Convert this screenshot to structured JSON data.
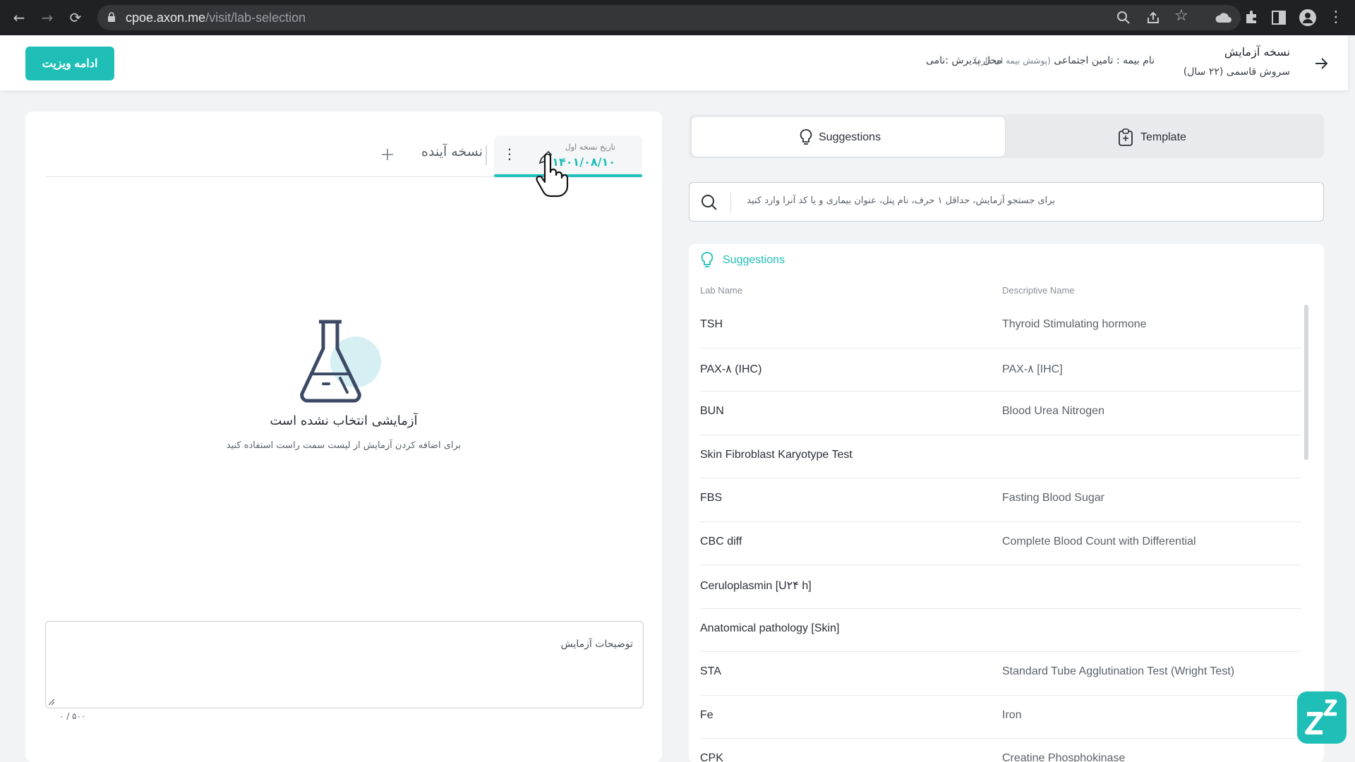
{
  "browser": {
    "url_host": "cpoe.axon.me",
    "url_path": "/visit/lab-selection"
  },
  "header": {
    "title": "نسخه آزمایش",
    "patient": "سروش قاسمی (۲۲ سال)",
    "insurance": "نام بیمه : تامین اجتماعی",
    "insurance_note": "(پوشش بیمه ای دارد)",
    "reception": "محل پذیرش :نامی",
    "continue_label": "ادامه ویزیت"
  },
  "left": {
    "tab_date_label": "تاریخ نسخه اول",
    "tab_date": "۱۴۰۱/۰۸/۱۰",
    "next_tab_label": "نسخه آینده",
    "empty_title": "آزمایشی انتخاب نشده است",
    "empty_subtitle": "برای اضافه کردن آزمایش از لیست سمت راست استفاده کنید",
    "notes_placeholder": "توضیحات آزمایش",
    "counter": "۰ / ۵۰۰"
  },
  "right": {
    "tab_suggestions": "Suggestions",
    "tab_template": "Template",
    "search_placeholder": "برای جستجو آزمایش، حداقل ۱ حرف، نام پنل، عنوان بیماری و یا کد آنرا وارد کنید",
    "list_title": "Suggestions",
    "col_lab": "Lab Name",
    "col_desc": "Descriptive Name",
    "rows": [
      {
        "lab": "TSH",
        "desc": "Thyroid Stimulating hormone"
      },
      {
        "lab": "PAX-۸ (IHC)",
        "desc": "PAX-۸ [IHC]"
      },
      {
        "lab": "BUN",
        "desc": "Blood Urea Nitrogen"
      },
      {
        "lab": "Skin Fibroblast Karyotype Test",
        "desc": ""
      },
      {
        "lab": "FBS",
        "desc": "Fasting Blood Sugar"
      },
      {
        "lab": "CBC diff",
        "desc": "Complete Blood Count with Differential"
      },
      {
        "lab": "Ceruloplasmin [U۲۴ h]",
        "desc": ""
      },
      {
        "lab": "Anatomical pathology [Skin]",
        "desc": ""
      },
      {
        "lab": "STA",
        "desc": "Standard Tube Agglutination Test (Wright Test)"
      },
      {
        "lab": "Fe",
        "desc": "Iron"
      },
      {
        "lab": "CPK",
        "desc": "Creatine Phosphokinase"
      }
    ]
  },
  "colors": {
    "accent": "#1fbfb8",
    "browser_bg": "#202124"
  }
}
